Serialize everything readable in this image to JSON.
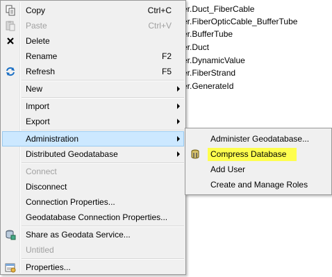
{
  "background_list": {
    "items": [
      "er.Duct_FiberCable",
      "er.FiberOpticCable_BufferTube",
      "er.BufferTube",
      "er.Duct",
      "er.DynamicValue",
      "er.FiberStrand",
      "er.GenerateId"
    ]
  },
  "context_menu": {
    "copy": {
      "label": "Copy",
      "shortcut": "Ctrl+C"
    },
    "paste": {
      "label": "Paste",
      "shortcut": "Ctrl+V"
    },
    "delete": {
      "label": "Delete"
    },
    "rename": {
      "label": "Rename",
      "shortcut": "F2"
    },
    "refresh": {
      "label": "Refresh",
      "shortcut": "F5"
    },
    "new": {
      "label": "New"
    },
    "import": {
      "label": "Import"
    },
    "export": {
      "label": "Export"
    },
    "administration": {
      "label": "Administration"
    },
    "distributed": {
      "label": "Distributed Geodatabase"
    },
    "connect": {
      "label": "Connect"
    },
    "disconnect": {
      "label": "Disconnect"
    },
    "connection_properties": {
      "label": "Connection Properties..."
    },
    "gdb_connection_properties": {
      "label": "Geodatabase Connection Properties..."
    },
    "share": {
      "label": "Share as Geodata Service..."
    },
    "untitled": {
      "label": "Untitled"
    },
    "properties": {
      "label": "Properties..."
    }
  },
  "admin_submenu": {
    "administer": {
      "label": "Administer Geodatabase..."
    },
    "compress": {
      "label": "Compress Database"
    },
    "add_user": {
      "label": "Add User"
    },
    "roles": {
      "label": "Create and Manage Roles"
    }
  },
  "colors": {
    "hover": "#cce8ff",
    "highlight": "#ffff3c",
    "disabled_text": "#a0a0a0"
  }
}
